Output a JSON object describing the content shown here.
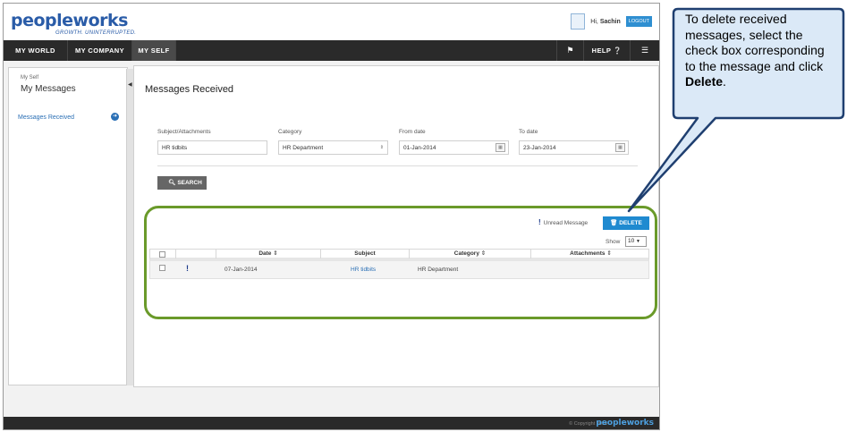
{
  "header": {
    "logo_text": "peopleworks",
    "logo_tagline": "GROWTH. UNINTERRUPTED.",
    "greeting_prefix": "Hi,",
    "user_name": "Sachin",
    "logout_label": "LOGOUT"
  },
  "nav": {
    "items": [
      {
        "label": "MY WORLD"
      },
      {
        "label": "MY COMPANY"
      },
      {
        "label": "MY SELF"
      }
    ],
    "help_label": "HELP"
  },
  "sidebar": {
    "crumb": "My Self",
    "title": "My Messages",
    "items": [
      {
        "label": "Messages Received"
      }
    ]
  },
  "main": {
    "title": "Messages Received",
    "filters": {
      "subject": {
        "label": "Subject/Attachments",
        "value": "HR tidbits"
      },
      "category": {
        "label": "Category",
        "value": "HR Department"
      },
      "from_date": {
        "label": "From date",
        "value": "01-Jan-2014"
      },
      "to_date": {
        "label": "To date",
        "value": "23-Jan-2014"
      }
    },
    "search_label": "SEARCH",
    "unread_label": "Unread Message",
    "delete_label": "DELETE",
    "show_label": "Show",
    "show_value": "10",
    "table": {
      "columns": [
        "Date",
        "Subject",
        "Category",
        "Attachments"
      ],
      "rows": [
        {
          "date": "07-Jan-2014",
          "subject": "HR tidbits",
          "category": "HR Department",
          "attachments": ""
        }
      ]
    }
  },
  "footer": {
    "copyright": "© Copyright 2014",
    "logo": "peopleworks"
  },
  "callout": {
    "text_before": "To delete received messages, select the check box corresponding to the message and click ",
    "bold": "Delete",
    "text_after": "."
  },
  "colors": {
    "brand_blue": "#2a5ca8",
    "nav_dark": "#2a2a2a",
    "action_blue": "#1f8ad0",
    "highlight_green": "#6a9a2a",
    "callout_fill": "#dbe9f7",
    "callout_border": "#1f3f70"
  }
}
